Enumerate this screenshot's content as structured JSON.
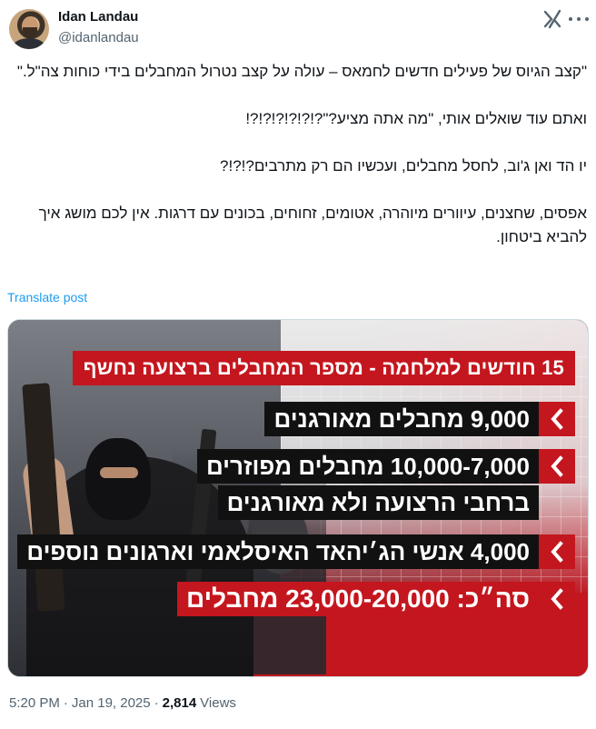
{
  "author": {
    "name": "Idan Landau",
    "handle": "@idanlandau"
  },
  "icons": {
    "grok": "grok-icon",
    "more": "more-options-icon",
    "chevron": "chevron-left-icon"
  },
  "tweet": {
    "paragraphs": [
      "\"קצב הגיוס של פעילים חדשים לחמאס – עולה על קצב נטרול המחבלים בידי כוחות צה\"ל.\"",
      "ואתם עוד שואלים אותי, \"מה אתה מציע?\"?!?!?!?!?!?!",
      "יו הד ואן ג'וב, לחסל מחבלים, ועכשיו הם רק מתרבים?!?!?",
      "אפסים, שחצנים, עיוורים מיוהרה, אטומים, זחוחים, בכונים עם דרגות. אין לכם מושג איך להביא ביטחון."
    ],
    "translate_label": "Translate post"
  },
  "media": {
    "headline": "15 חודשים למלחמה - מספר המחבלים ברצועה נחשף",
    "rows": [
      "9,000 מחבלים מאורגנים",
      "10,000-7,000 מחבלים מפוזרים",
      "ברחבי הרצועה ולא מאורגנים",
      "4,000 אנשי הג׳יהאד האיסלאמי וארגונים נוספים",
      "סה״כ: 23,000-20,000 מחבלים"
    ],
    "colors": {
      "accent_red": "#c4161e",
      "bar_black": "#111111"
    }
  },
  "footer": {
    "time": "5:20 PM",
    "separator": "·",
    "date": "Jan 19, 2025",
    "views_count": "2,814",
    "views_label": "Views"
  }
}
